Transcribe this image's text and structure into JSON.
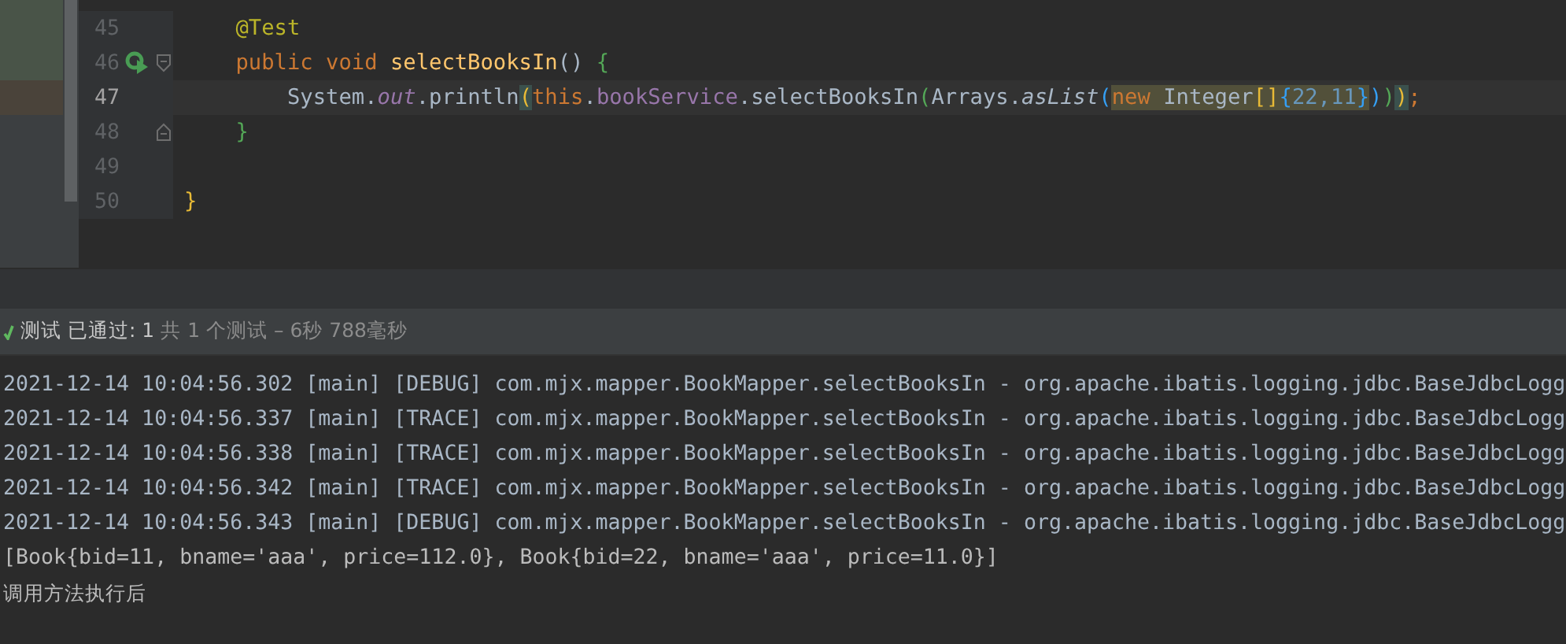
{
  "editor": {
    "lines": [
      {
        "number": "45",
        "run_marker": false,
        "fold_open": false,
        "fold_close": false,
        "current": false,
        "tokens": [
          {
            "text": "    @Test",
            "kind": "annotation"
          }
        ]
      },
      {
        "number": "46",
        "run_marker": true,
        "fold_open": true,
        "fold_close": false,
        "current": false,
        "tokens": [
          {
            "text": "    public void ",
            "kind": "keyword"
          },
          {
            "text": "selectBooksIn",
            "kind": "declaration"
          },
          {
            "text": "() ",
            "kind": "plain"
          },
          {
            "text": "{",
            "kind": "brace2"
          }
        ]
      },
      {
        "number": "47",
        "run_marker": false,
        "fold_open": false,
        "fold_close": false,
        "current": true,
        "tokens": [
          {
            "text": "        System.",
            "kind": "plain"
          },
          {
            "text": "out",
            "kind": "field",
            "italic": true
          },
          {
            "text": ".println",
            "kind": "plain"
          },
          {
            "text": "(",
            "kind": "brace1",
            "brace_match": true
          },
          {
            "text": "this",
            "kind": "keyword"
          },
          {
            "text": ".",
            "kind": "plain"
          },
          {
            "text": "bookService",
            "kind": "field"
          },
          {
            "text": ".selectBooksIn",
            "kind": "plain"
          },
          {
            "text": "(",
            "kind": "brace2"
          },
          {
            "text": "Arrays.",
            "kind": "plain"
          },
          {
            "text": "asList",
            "kind": "plain",
            "italic": true
          },
          {
            "text": "(",
            "kind": "brace3"
          },
          {
            "text": "new",
            "kind": "keyword",
            "highlighted": true
          },
          {
            "text": " Integer",
            "kind": "plain",
            "highlighted": true
          },
          {
            "text": "[]",
            "kind": "brace1",
            "highlighted": true
          },
          {
            "text": "{",
            "kind": "brace3",
            "highlighted": true
          },
          {
            "text": "22,11",
            "kind": "number",
            "highlighted": true
          },
          {
            "text": "}",
            "kind": "brace3",
            "highlighted": true
          },
          {
            "text": ")",
            "kind": "brace3"
          },
          {
            "text": ")",
            "kind": "brace2"
          },
          {
            "text": ")",
            "kind": "brace1",
            "brace_match": true
          },
          {
            "text": ";",
            "kind": "keyword"
          }
        ]
      },
      {
        "number": "48",
        "run_marker": false,
        "fold_open": false,
        "fold_close": true,
        "current": false,
        "tokens": [
          {
            "text": "    }",
            "kind": "brace2"
          }
        ]
      },
      {
        "number": "49",
        "run_marker": false,
        "fold_open": false,
        "fold_close": false,
        "current": false
      },
      {
        "number": "50",
        "run_marker": false,
        "fold_open": false,
        "fold_close": false,
        "current": false,
        "tokens": [
          {
            "text": "}",
            "kind": "brace1"
          }
        ]
      }
    ]
  },
  "test_status": {
    "passed": true,
    "label": "测试 已通过: 1",
    "detail": "共 1 个测试 – 6秒 788毫秒"
  },
  "console": {
    "lines": [
      {
        "kind": "log",
        "text": "2021-12-14 10:04:56.302 [main] [DEBUG] com.mjx.mapper.BookMapper.selectBooksIn - org.apache.ibatis.logging.jdbc.BaseJdbcLogg"
      },
      {
        "kind": "log",
        "text": "2021-12-14 10:04:56.337 [main] [TRACE] com.mjx.mapper.BookMapper.selectBooksIn - org.apache.ibatis.logging.jdbc.BaseJdbcLogg"
      },
      {
        "kind": "log",
        "text": "2021-12-14 10:04:56.338 [main] [TRACE] com.mjx.mapper.BookMapper.selectBooksIn - org.apache.ibatis.logging.jdbc.BaseJdbcLogg"
      },
      {
        "kind": "log",
        "text": "2021-12-14 10:04:56.342 [main] [TRACE] com.mjx.mapper.BookMapper.selectBooksIn - org.apache.ibatis.logging.jdbc.BaseJdbcLogg"
      },
      {
        "kind": "log",
        "text": "2021-12-14 10:04:56.343 [main] [DEBUG] com.mjx.mapper.BookMapper.selectBooksIn - org.apache.ibatis.logging.jdbc.BaseJdbcLogg"
      },
      {
        "kind": "stdout",
        "text": "[Book{bid=11, bname='aaa', price=112.0}, Book{bid=22, bname='aaa', price=11.0}]"
      },
      {
        "kind": "stdout",
        "text": "调用方法执行后"
      }
    ]
  }
}
